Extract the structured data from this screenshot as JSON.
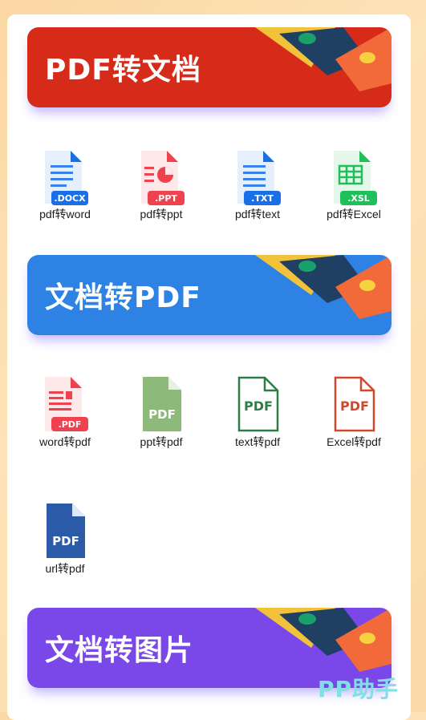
{
  "banners": {
    "pdf_to_doc": "PDF转文档",
    "doc_to_pdf": "文档转PDF",
    "doc_to_image": "文档转图片"
  },
  "section1": [
    {
      "label": "pdf转word",
      "badge": ".DOCX",
      "icon": "docx-file-icon",
      "color": "#1a6fe6"
    },
    {
      "label": "pdf转ppt",
      "badge": ".PPT",
      "icon": "ppt-file-icon",
      "color": "#f0424e"
    },
    {
      "label": "pdf转text",
      "badge": ".TXT",
      "icon": "txt-file-icon",
      "color": "#1a6fe6"
    },
    {
      "label": "pdf转Excel",
      "badge": ".XSL",
      "icon": "xsl-file-icon",
      "color": "#1fbf5a"
    }
  ],
  "section2": [
    {
      "label": "word转pdf",
      "badge": ".PDF",
      "icon": "pdf-file-icon",
      "color": "#f0424e"
    },
    {
      "label": "ppt转pdf",
      "badge": "PDF",
      "icon": "green-pdf-file-icon",
      "color": "#8dba7a"
    },
    {
      "label": "text转pdf",
      "badge": "PDF",
      "icon": "outline-pdf-file-icon",
      "color": "#2e7d46"
    },
    {
      "label": "Excel转pdf",
      "badge": "PDF",
      "icon": "red-outline-pdf-file-icon",
      "color": "#d0492e"
    },
    {
      "label": "url转pdf",
      "badge": "PDF",
      "icon": "blue-pdf-file-icon",
      "color": "#2b5aa8"
    }
  ],
  "watermark": "PP助手"
}
